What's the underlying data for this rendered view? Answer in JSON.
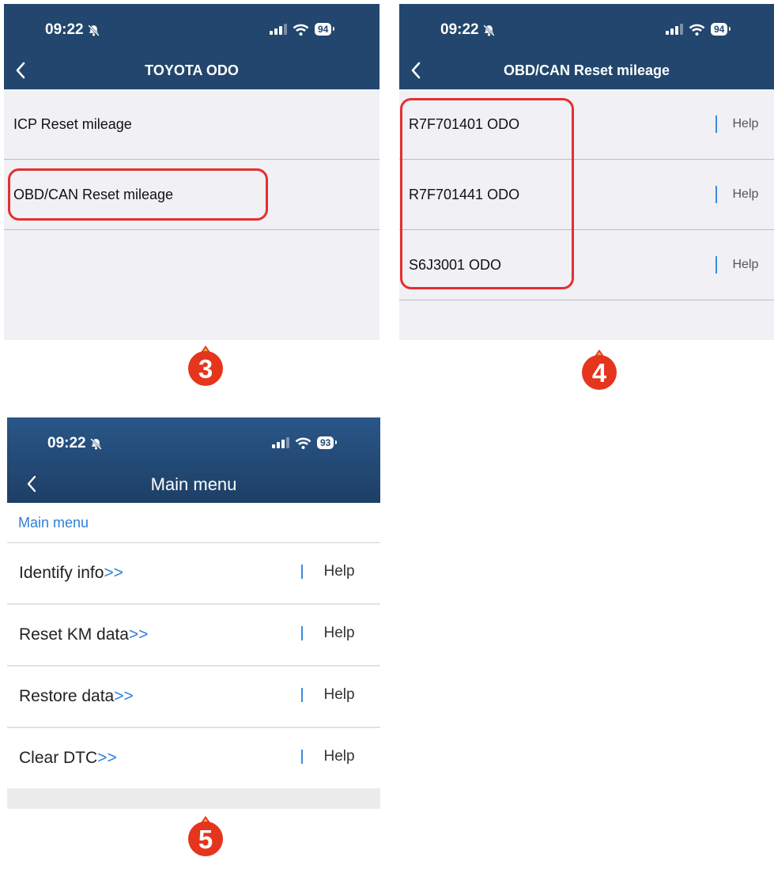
{
  "screens": [
    {
      "status": {
        "time": "09:22",
        "battery": "94"
      },
      "title": "TOYOTA ODO",
      "items": [
        {
          "label": "ICP Reset mileage"
        },
        {
          "label": "OBD/CAN Reset mileage"
        }
      ],
      "step": "3"
    },
    {
      "status": {
        "time": "09:22",
        "battery": "94"
      },
      "title": "OBD/CAN Reset mileage",
      "items": [
        {
          "label": "R7F701401 ODO",
          "help": "Help"
        },
        {
          "label": "R7F701441 ODO",
          "help": "Help"
        },
        {
          "label": "S6J3001 ODO",
          "help": "Help"
        }
      ],
      "step": "4"
    },
    {
      "status": {
        "time": "09:22",
        "battery": "93"
      },
      "title": "Main menu",
      "breadcrumb": "Main menu",
      "items": [
        {
          "label": "Identify info",
          "arrow": ">>",
          "help": "Help"
        },
        {
          "label": "Reset KM data",
          "arrow": ">>",
          "help": "Help"
        },
        {
          "label": "Restore data",
          "arrow": ">>",
          "help": "Help"
        },
        {
          "label": "Clear DTC",
          "arrow": ">>",
          "help": "Help"
        }
      ],
      "step": "5"
    }
  ],
  "colors": {
    "header": "#22466d",
    "highlight": "#e3302f",
    "link": "#2f7fd8",
    "badge": "#e5351c"
  }
}
